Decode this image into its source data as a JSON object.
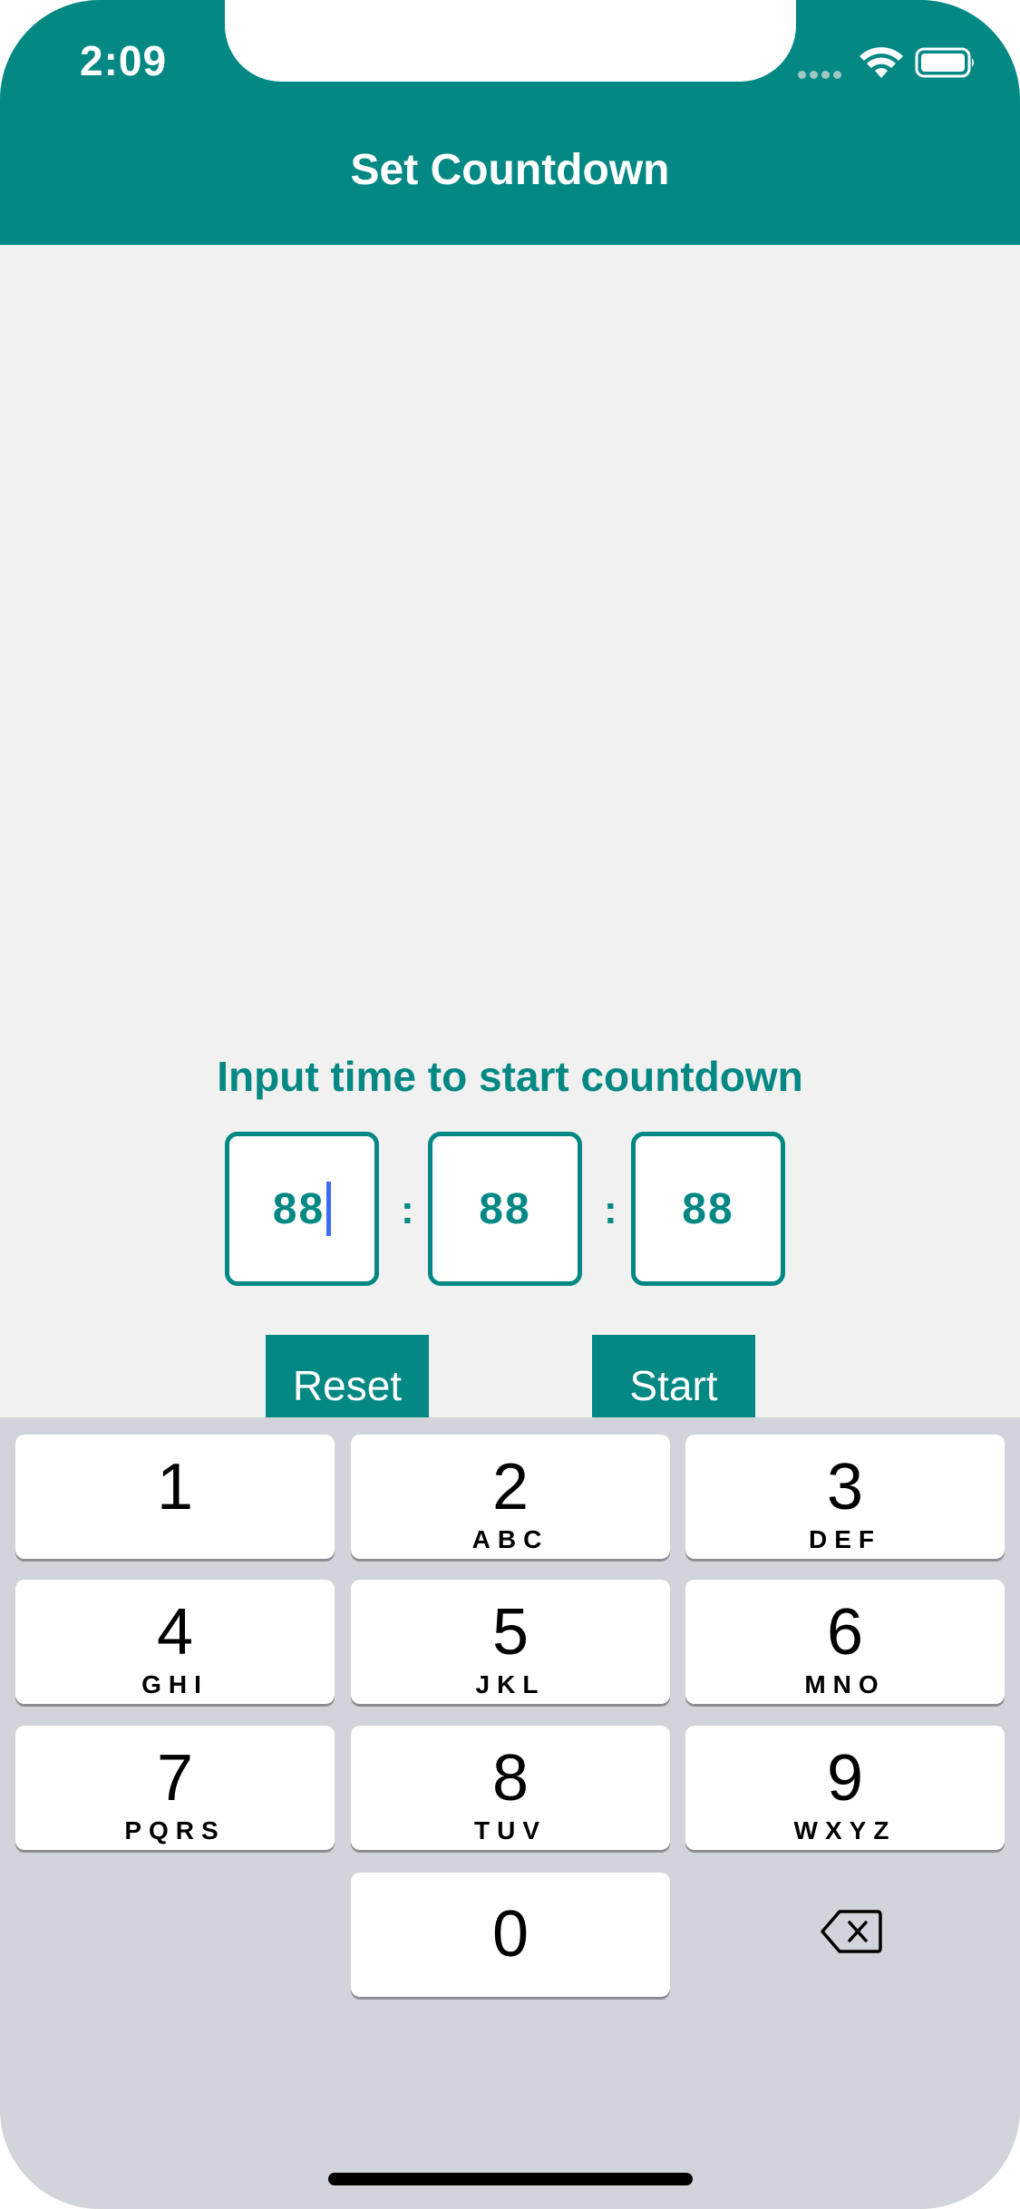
{
  "status_bar": {
    "time": "2:09"
  },
  "header": {
    "title": "Set Countdown"
  },
  "main": {
    "prompt": "Input time to start countdown",
    "hours": "88",
    "minutes": "88",
    "seconds": "88",
    "separator": ":",
    "reset_label": "Reset",
    "start_label": "Start"
  },
  "keyboard": {
    "keys": [
      {
        "num": "1",
        "letters": ""
      },
      {
        "num": "2",
        "letters": "ABC"
      },
      {
        "num": "3",
        "letters": "DEF"
      },
      {
        "num": "4",
        "letters": "GHI"
      },
      {
        "num": "5",
        "letters": "JKL"
      },
      {
        "num": "6",
        "letters": "MNO"
      },
      {
        "num": "7",
        "letters": "PQRS"
      },
      {
        "num": "8",
        "letters": "TUV"
      },
      {
        "num": "9",
        "letters": "WXYZ"
      },
      {
        "num": "0",
        "letters": ""
      }
    ]
  },
  "colors": {
    "accent": "#038884",
    "keyboard_bg": "#d1d4da",
    "content_bg": "#f1f1f1",
    "cursor": "#3b6cf4"
  },
  "icons": [
    "wifi-icon",
    "battery-icon",
    "signal-dots-icon",
    "delete-backspace-icon"
  ]
}
